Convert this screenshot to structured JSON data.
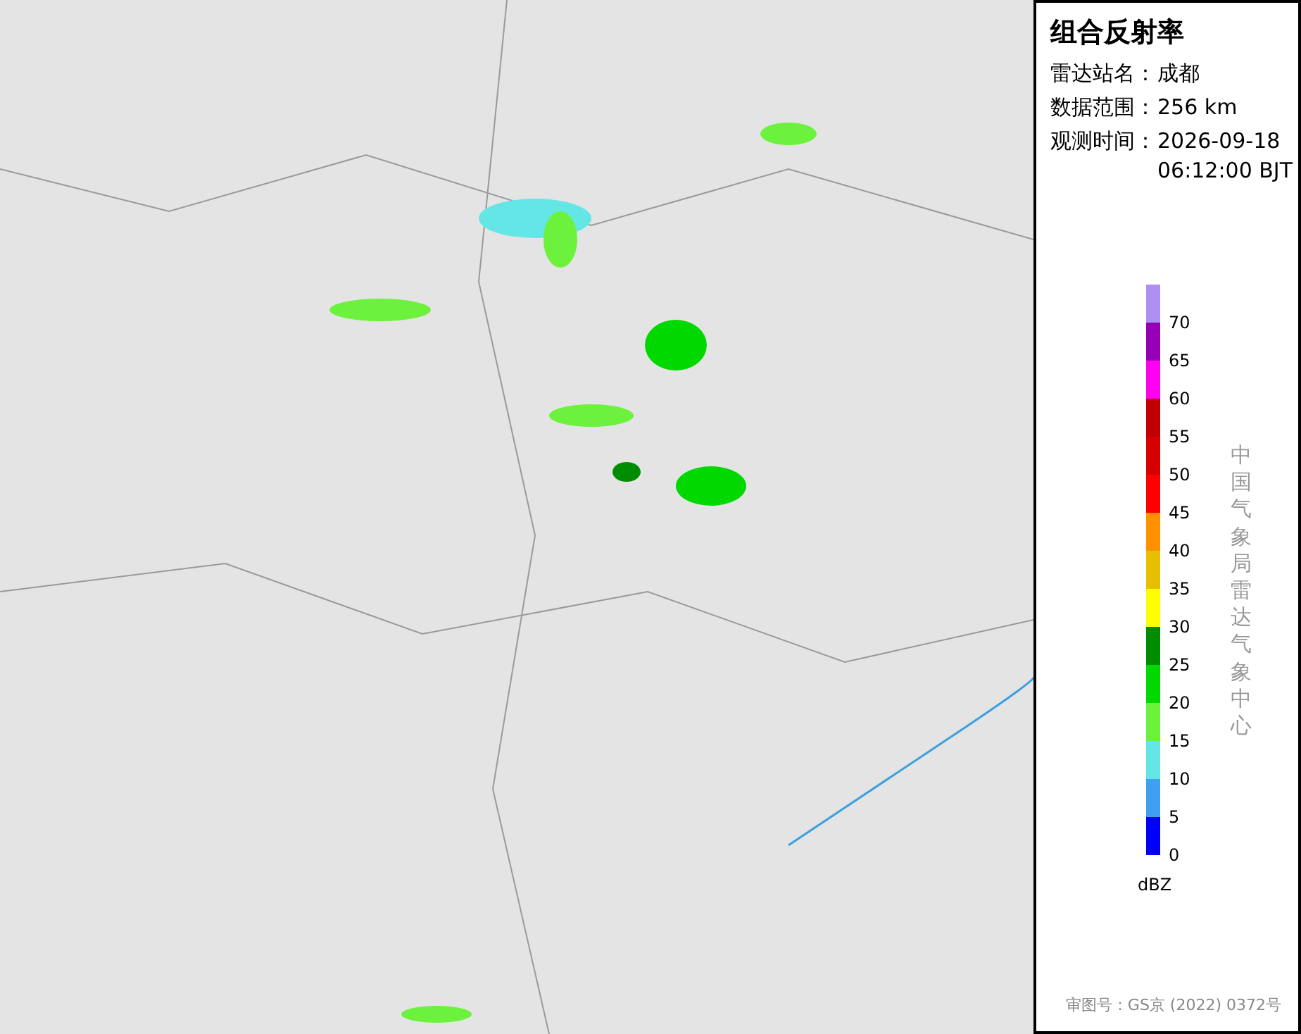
{
  "title": "组合反射率",
  "info": [
    {
      "label": "雷达站名：",
      "lines": [
        "成都"
      ]
    },
    {
      "label": "数据范围：",
      "lines": [
        "256 km"
      ]
    },
    {
      "label": "观测时间：",
      "lines": [
        "2026-09-18",
        "06:12:00 BJT"
      ]
    }
  ],
  "legend": {
    "segments": [
      {
        "color": "#ad90f0"
      },
      {
        "color": "#9600b4"
      },
      {
        "color": "#ff00f0"
      },
      {
        "color": "#c00000"
      },
      {
        "color": "#d60000"
      },
      {
        "color": "#ff0000"
      },
      {
        "color": "#ff9000"
      },
      {
        "color": "#e6c000"
      },
      {
        "color": "#ffff00"
      },
      {
        "color": "#008c00"
      },
      {
        "color": "#00d800"
      },
      {
        "color": "#6cf23c"
      },
      {
        "color": "#64e6e6"
      },
      {
        "color": "#40a0f0"
      },
      {
        "color": "#0000f6"
      }
    ],
    "ticks": [
      "70",
      "65",
      "60",
      "55",
      "50",
      "45",
      "40",
      "35",
      "30",
      "25",
      "20",
      "15",
      "10",
      "5",
      "0"
    ],
    "unit": "dBZ"
  },
  "credit": "中国气象局雷达气象中心",
  "approval": "审图号：GS京 (2022) 0372号"
}
